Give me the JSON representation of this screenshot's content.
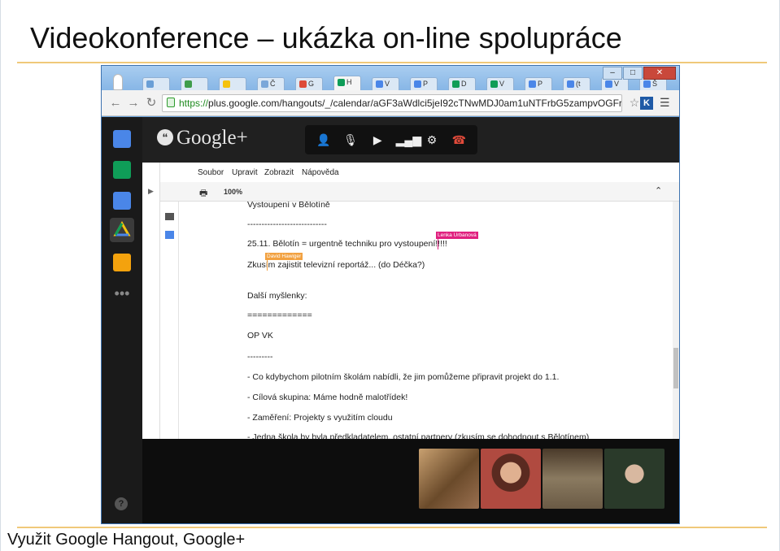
{
  "slide": {
    "title": "Videokonference – ukázka on-line spolupráce",
    "caption": "Využit Google Hangout, Google+"
  },
  "browser": {
    "tabs": [
      {
        "label": "",
        "color": "#6a9fd6"
      },
      {
        "label": "",
        "color": "#3f9d4b"
      },
      {
        "label": "",
        "color": "#f4c20d"
      },
      {
        "label": "Č",
        "color": "#7aa7d9"
      },
      {
        "label": "G",
        "color": "#dd4b39"
      },
      {
        "label": "H",
        "color": "#0f9d58"
      },
      {
        "label": "V",
        "color": "#4a86e8"
      },
      {
        "label": "P",
        "color": "#4a86e8"
      },
      {
        "label": "D",
        "color": "#0f9d58"
      },
      {
        "label": "V",
        "color": "#0f9d58"
      },
      {
        "label": "P",
        "color": "#4a86e8"
      },
      {
        "label": "(t",
        "color": "#4a86e8"
      },
      {
        "label": "V",
        "color": "#4a86e8"
      },
      {
        "label": "Š",
        "color": "#4a86e8"
      }
    ],
    "window_buttons": [
      "minimize-icon",
      "maximize-icon",
      "close-icon"
    ],
    "url_https": "https://",
    "url_rest": "plus.google.com/hangouts/_/calendar/aGF3aWdlci5jeI92cTNwMDJ0am1uNTFrbG5zampvOGFrYzE5"
  },
  "hangout": {
    "logo": "Google+",
    "controls": [
      "invite-icon",
      "mic-muted-icon",
      "camera-off-icon",
      "bandwidth-icon",
      "settings-icon",
      "hang-up-icon"
    ],
    "rail_icons": [
      {
        "name": "chat-icon",
        "color": "#4a86e8"
      },
      {
        "name": "screenshare-icon",
        "color": "#0f9d58"
      },
      {
        "name": "capture-icon",
        "color": "#4a86e8"
      },
      {
        "name": "drive-icon",
        "color": "#f4c20d"
      },
      {
        "name": "toolbox-icon",
        "color": "#f4a20d"
      },
      {
        "name": "more-icon",
        "color": "#888888"
      }
    ],
    "help": "?"
  },
  "doc": {
    "menu": [
      "Soubor",
      "Upravit",
      "Zobrazit",
      "Nápověda"
    ],
    "zoom": "100%",
    "lines": [
      "Vystoupení v Bělotíně",
      "----------------------------",
      "25.11. Bělotín = urgentně techniku pro vystoupení!!!!!",
      "Zkusím zajistit televizní reportáž... (do Déčka?)",
      "",
      "Další myšlenky:",
      "=============",
      "OP VK",
      "---------",
      "- Co kdybychom pilotním školám nabídli, že jim pomůžeme připravit projekt do 1.1.",
      "- Cílová skupina: Máme hodně malotřídek!",
      "- Zaměření: Projekty s využitím cloudu",
      "- Jedna škola by byla předkladatelem, ostatní partnery (zkusím se dohodnout s Bělotínem)"
    ],
    "collaborators": [
      {
        "name": "Lenka Urbanová",
        "color": "#e0207f"
      },
      {
        "name": "David Hawiger",
        "color": "#f2a140"
      }
    ]
  },
  "participants": [
    {
      "name": "participant-1",
      "color": "#7a5a3a"
    },
    {
      "name": "participant-2",
      "color": "#b05040"
    },
    {
      "name": "participant-3",
      "color": "#7a6a55"
    },
    {
      "name": "participant-4",
      "color": "#3a4a3a"
    }
  ]
}
